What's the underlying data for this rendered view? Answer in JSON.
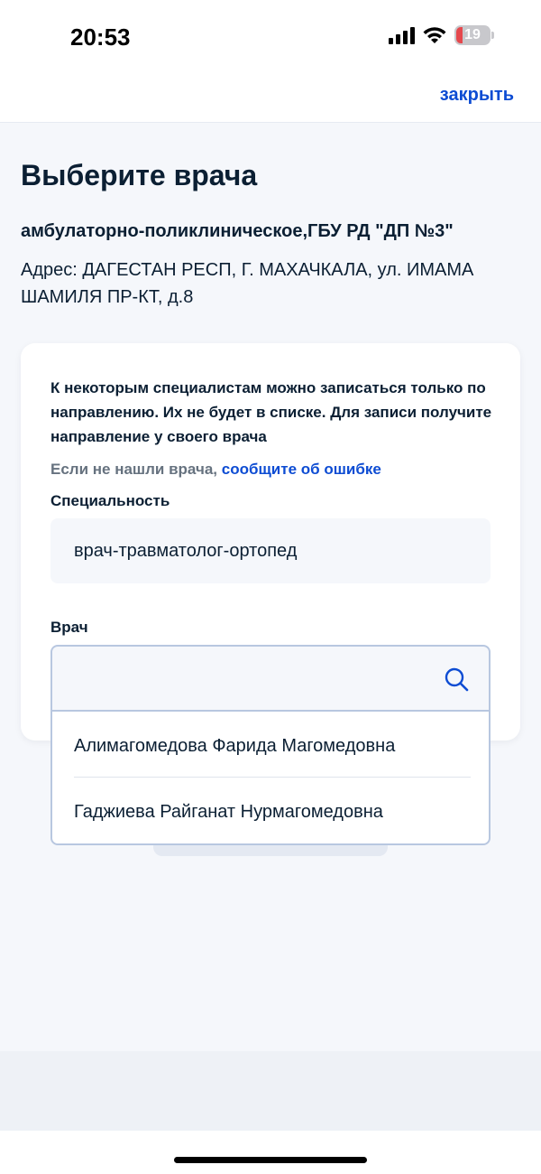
{
  "status": {
    "time": "20:53",
    "battery": "19",
    "icons": [
      "signal-icon",
      "wifi-icon",
      "battery-icon"
    ]
  },
  "header": {
    "close_label": "закрыть"
  },
  "page": {
    "title": "Выберите врача",
    "org_name": "амбулаторно-поликлиническое,ГБУ РД \"ДП №3\"",
    "address": "Адрес: ДАГЕСТАН РЕСП, Г. МАХАЧКАЛА, ул. ИМАМА ШАМИЛЯ ПР-КТ, д.8"
  },
  "card": {
    "info": "К некоторым специалистам можно записаться только по направлению. Их не будет в списке. Для записи получите направление у своего врача",
    "report_prefix": "Если не нашли врача,",
    "report_link": "сообщите об ошибке",
    "specialty_label": "Специальность",
    "specialty_value": "врач-травматолог-ортопед",
    "doctor_label": "Врач",
    "doctor_value": "",
    "doctor_placeholder": ""
  },
  "dropdown": {
    "items": [
      {
        "label": "Алимагомедова Фарида Магомедовна"
      },
      {
        "label": "Гаджиева Райганат Нурмагомедовна"
      }
    ]
  },
  "colors": {
    "accent": "#0d4cd3",
    "text": "#0b1f33",
    "muted": "#66727f",
    "background": "#f5f7fb",
    "border": "#b8c7e0",
    "battery_low": "#e5484d"
  }
}
